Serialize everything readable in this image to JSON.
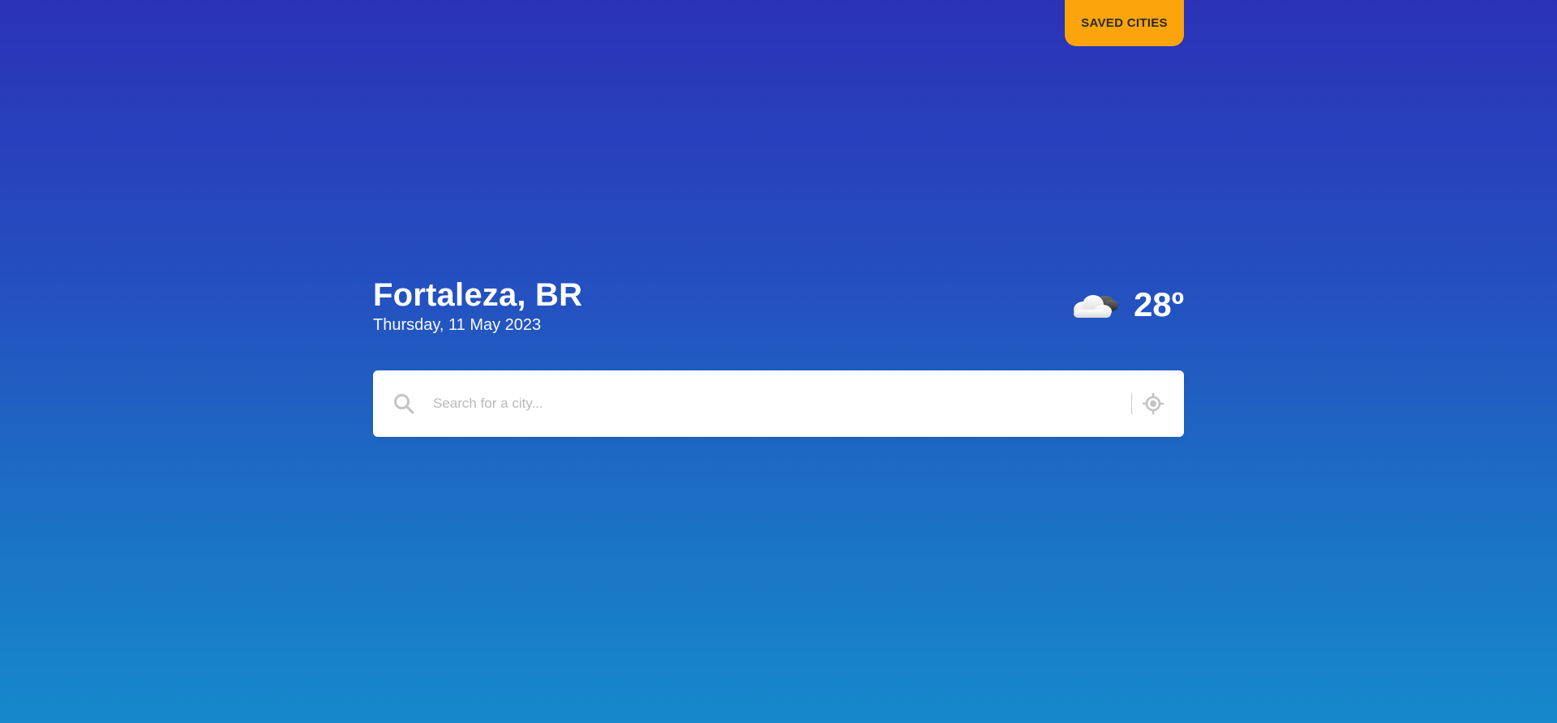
{
  "header": {
    "saved_cities_label": "SAVED CITIES"
  },
  "location": {
    "city": "Fortaleza, BR",
    "date": "Thursday, 11 May 2023"
  },
  "weather": {
    "icon": "cloud-night-icon",
    "temperature": "28º"
  },
  "search": {
    "placeholder": "Search for a city...",
    "value": ""
  },
  "colors": {
    "accent": "#fba40c",
    "gradient_top": "#2b32b6",
    "gradient_bottom": "#1589cc"
  }
}
